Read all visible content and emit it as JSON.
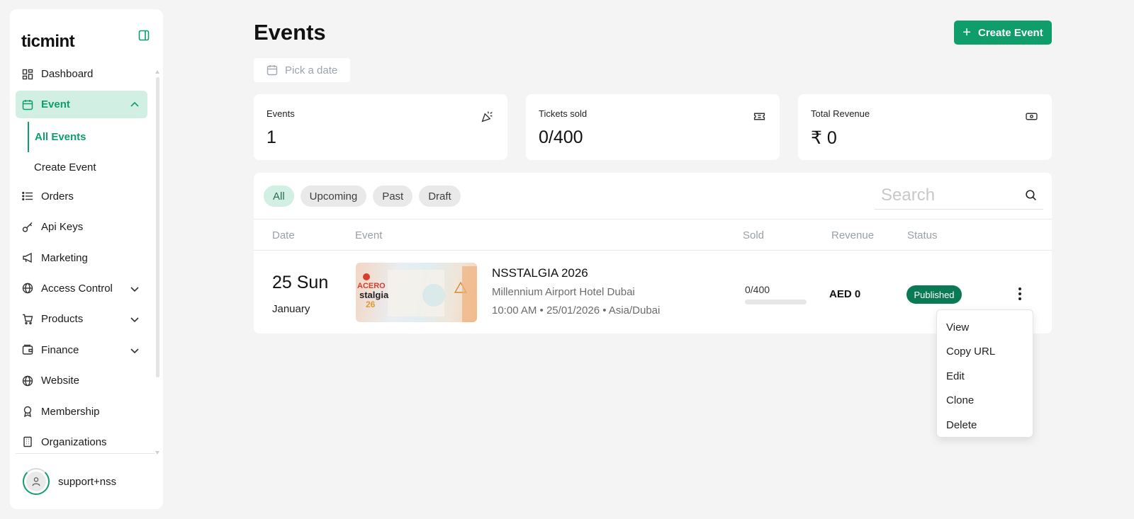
{
  "app": {
    "brand": "ticmint"
  },
  "sidebar": {
    "items": [
      {
        "label": "Dashboard",
        "icon": "dashboard-icon"
      },
      {
        "label": "Event",
        "icon": "calendar-icon",
        "expanded": true,
        "active": true
      },
      {
        "label": "Orders",
        "icon": "list-icon"
      },
      {
        "label": "Api Keys",
        "icon": "key-icon"
      },
      {
        "label": "Marketing",
        "icon": "megaphone-icon"
      },
      {
        "label": "Access Control",
        "icon": "globe-lock-icon",
        "expandable": true
      },
      {
        "label": "Products",
        "icon": "cart-icon",
        "expandable": true
      },
      {
        "label": "Finance",
        "icon": "wallet-icon",
        "expandable": true
      },
      {
        "label": "Website",
        "icon": "globe-icon"
      },
      {
        "label": "Membership",
        "icon": "award-icon"
      },
      {
        "label": "Organizations",
        "icon": "building-icon"
      }
    ],
    "event_sub": [
      {
        "label": "All Events",
        "selected": true
      },
      {
        "label": "Create Event"
      }
    ],
    "user": {
      "name": "support+nss"
    }
  },
  "header": {
    "title": "Events",
    "create_label": "Create Event",
    "date_placeholder": "Pick a date"
  },
  "stats": [
    {
      "label": "Events",
      "value": "1",
      "icon": "party-popper-icon"
    },
    {
      "label": "Tickets sold",
      "value": "0/400",
      "icon": "ticket-icon"
    },
    {
      "label": "Total Revenue",
      "value": "₹ 0",
      "icon": "banknote-icon"
    }
  ],
  "filters": [
    "All",
    "Upcoming",
    "Past",
    "Draft"
  ],
  "active_filter": "All",
  "search": {
    "placeholder": "Search"
  },
  "table": {
    "headers": [
      "Date",
      "Event",
      "Sold",
      "Revenue",
      "Status"
    ],
    "rows": [
      {
        "date": "25 Sun",
        "month": "January",
        "thumb_text": "ACERO stalgia 26",
        "name": "NSSTALGIA 2026",
        "venue": "Millennium Airport Hotel Dubai",
        "time": "10:00 AM • 25/01/2026 • Asia/Dubai",
        "sold": "0/400",
        "sold_fraction": 0,
        "revenue": "AED 0",
        "status": "Published"
      }
    ]
  },
  "row_menu": [
    "View",
    "Copy URL",
    "Edit",
    "Clone",
    "Delete"
  ],
  "colors": {
    "accent": "#0f9d6c",
    "status_published": "#0a7a55",
    "active_bg": "#d2efe3"
  }
}
